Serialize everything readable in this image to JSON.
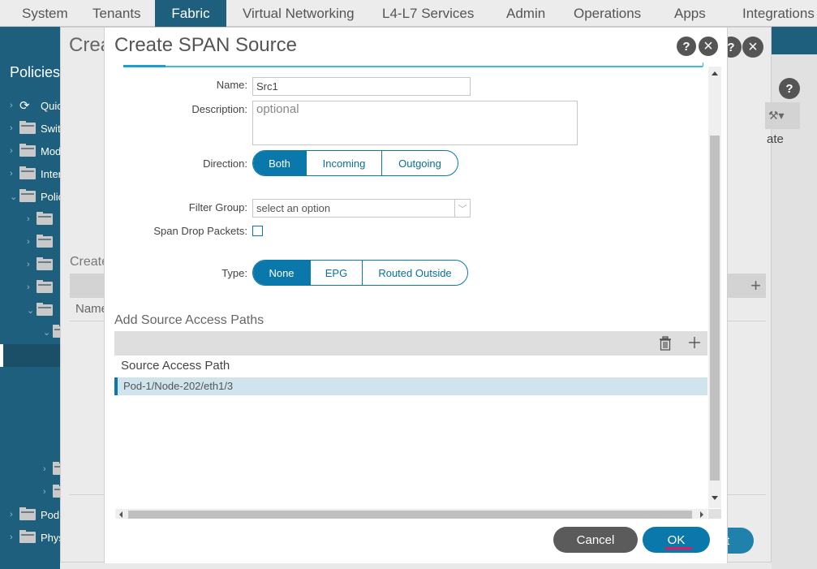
{
  "topnav": {
    "tabs": [
      {
        "label": "System",
        "active": false
      },
      {
        "label": "Tenants",
        "active": false
      },
      {
        "label": "Fabric",
        "active": true
      },
      {
        "label": "Virtual Networking",
        "active": false
      },
      {
        "label": "L4-L7 Services",
        "active": false
      },
      {
        "label": "Admin",
        "active": false
      },
      {
        "label": "Operations",
        "active": false
      },
      {
        "label": "Apps",
        "active": false
      },
      {
        "label": "Integrations",
        "active": false
      }
    ]
  },
  "sidebar": {
    "title": "Policies",
    "items": [
      {
        "label": "Quick Start",
        "icon": "quick-start-icon"
      },
      {
        "label": "Switches",
        "icon": "folder-icon"
      },
      {
        "label": "Modules",
        "icon": "folder-icon"
      },
      {
        "label": "Interfaces",
        "icon": "folder-icon"
      },
      {
        "label": "Policies",
        "icon": "folder-icon",
        "expanded": true
      },
      {
        "label": "Pod",
        "icon": "folder-icon"
      },
      {
        "label": "Physical and External Domains",
        "icon": "folder-icon"
      }
    ]
  },
  "background_dialog": {
    "title": "Create",
    "subheading": "Create",
    "column": "Name",
    "tool_label": "ate",
    "submit_fragment": "t"
  },
  "modal": {
    "title": "Create SPAN Source",
    "help_label": "?",
    "close_label": "×",
    "form": {
      "name_label": "Name:",
      "name_value": "Src1",
      "description_label": "Description:",
      "description_placeholder": "optional",
      "direction_label": "Direction:",
      "direction_options": [
        "Both",
        "Incoming",
        "Outgoing"
      ],
      "direction_selected": "Both",
      "filter_group_label": "Filter Group:",
      "filter_group_placeholder": "select an option",
      "span_drop_label": "Span Drop Packets:",
      "span_drop_checked": false,
      "type_label": "Type:",
      "type_options": [
        "None",
        "EPG",
        "Routed Outside"
      ],
      "type_selected": "None"
    },
    "access_paths": {
      "title": "Add Source Access Paths",
      "column_header": "Source Access Path",
      "rows": [
        "Pod-1/Node-202/eth1/3"
      ]
    },
    "footer": {
      "cancel_label": "Cancel",
      "ok_label": "OK"
    }
  },
  "colors": {
    "nav_active": "#1e5f7d",
    "accent": "#0a78aa",
    "row_selected": "#cfe4ed",
    "cancel": "#5b5b5b",
    "ok_underline": "#e8175d"
  }
}
